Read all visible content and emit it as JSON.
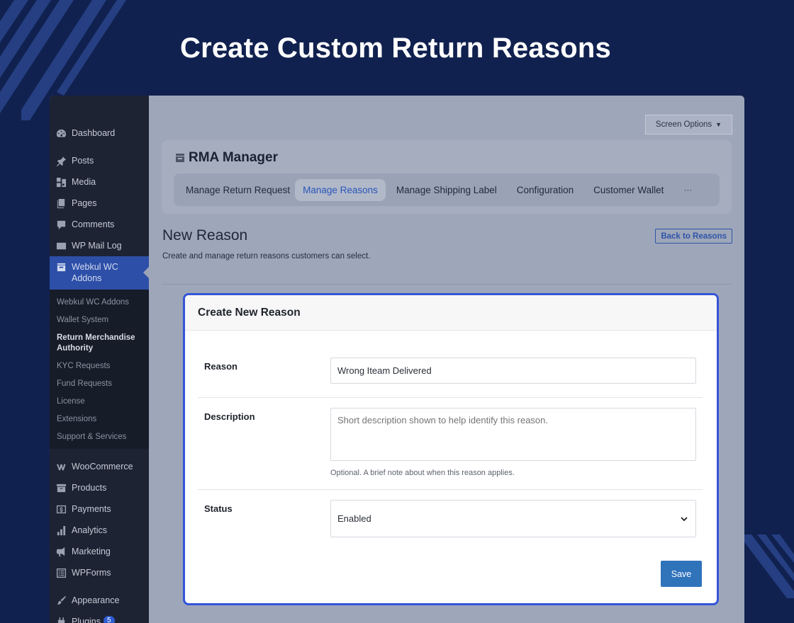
{
  "banner": {
    "title": "Create Custom Return Reasons"
  },
  "sidebar": {
    "items_top": [
      {
        "label": "Dashboard",
        "icon": "dashboard-icon"
      },
      {
        "label": "Posts",
        "icon": "pin-icon"
      },
      {
        "label": "Media",
        "icon": "media-icon"
      },
      {
        "label": "Pages",
        "icon": "pages-icon"
      },
      {
        "label": "Comments",
        "icon": "comment-icon"
      },
      {
        "label": "WP Mail Log",
        "icon": "mail-icon"
      }
    ],
    "active_item": {
      "label": "Webkul WC Addons",
      "icon": "store-icon"
    },
    "submenu": [
      "Webkul WC Addons",
      "Wallet System",
      "Return Merchandise Authority",
      "KYC Requests",
      "Fund Requests",
      "License",
      "Extensions",
      "Support & Services"
    ],
    "submenu_current_index": 2,
    "items_bottom": [
      {
        "label": "WooCommerce",
        "icon": "woo-icon"
      },
      {
        "label": "Products",
        "icon": "archive-icon"
      },
      {
        "label": "Payments",
        "icon": "dollar-icon"
      },
      {
        "label": "Analytics",
        "icon": "bar-chart-icon"
      },
      {
        "label": "Marketing",
        "icon": "megaphone-icon"
      },
      {
        "label": "WPForms",
        "icon": "form-icon"
      },
      {
        "label": "Appearance",
        "icon": "brush-icon"
      },
      {
        "label": "Plugins",
        "icon": "plugin-icon",
        "badge": "5"
      }
    ]
  },
  "header": {
    "screen_options": "Screen Options"
  },
  "rma": {
    "title": "RMA Manager",
    "tabs": [
      "Manage Return Request",
      "Manage Reasons",
      "Manage Shipping Label",
      "Configuration",
      "Customer Wallet",
      "···"
    ],
    "active_tab": 1
  },
  "page": {
    "title": "New Reason",
    "back_label": "Back to Reasons",
    "subtitle": "Create and manage return reasons customers can select."
  },
  "form": {
    "title": "Create New Reason",
    "reason_label": "Reason",
    "reason_value": "Wrong Iteam Delivered",
    "description_label": "Description",
    "description_placeholder": "Short description shown to help identify this reason.",
    "description_help": "Optional. A brief note about when this reason applies.",
    "status_label": "Status",
    "status_value": "Enabled",
    "save_label": "Save"
  },
  "colors": {
    "accent": "#3454d8",
    "button": "#2f73bb",
    "background": "#11214f"
  }
}
